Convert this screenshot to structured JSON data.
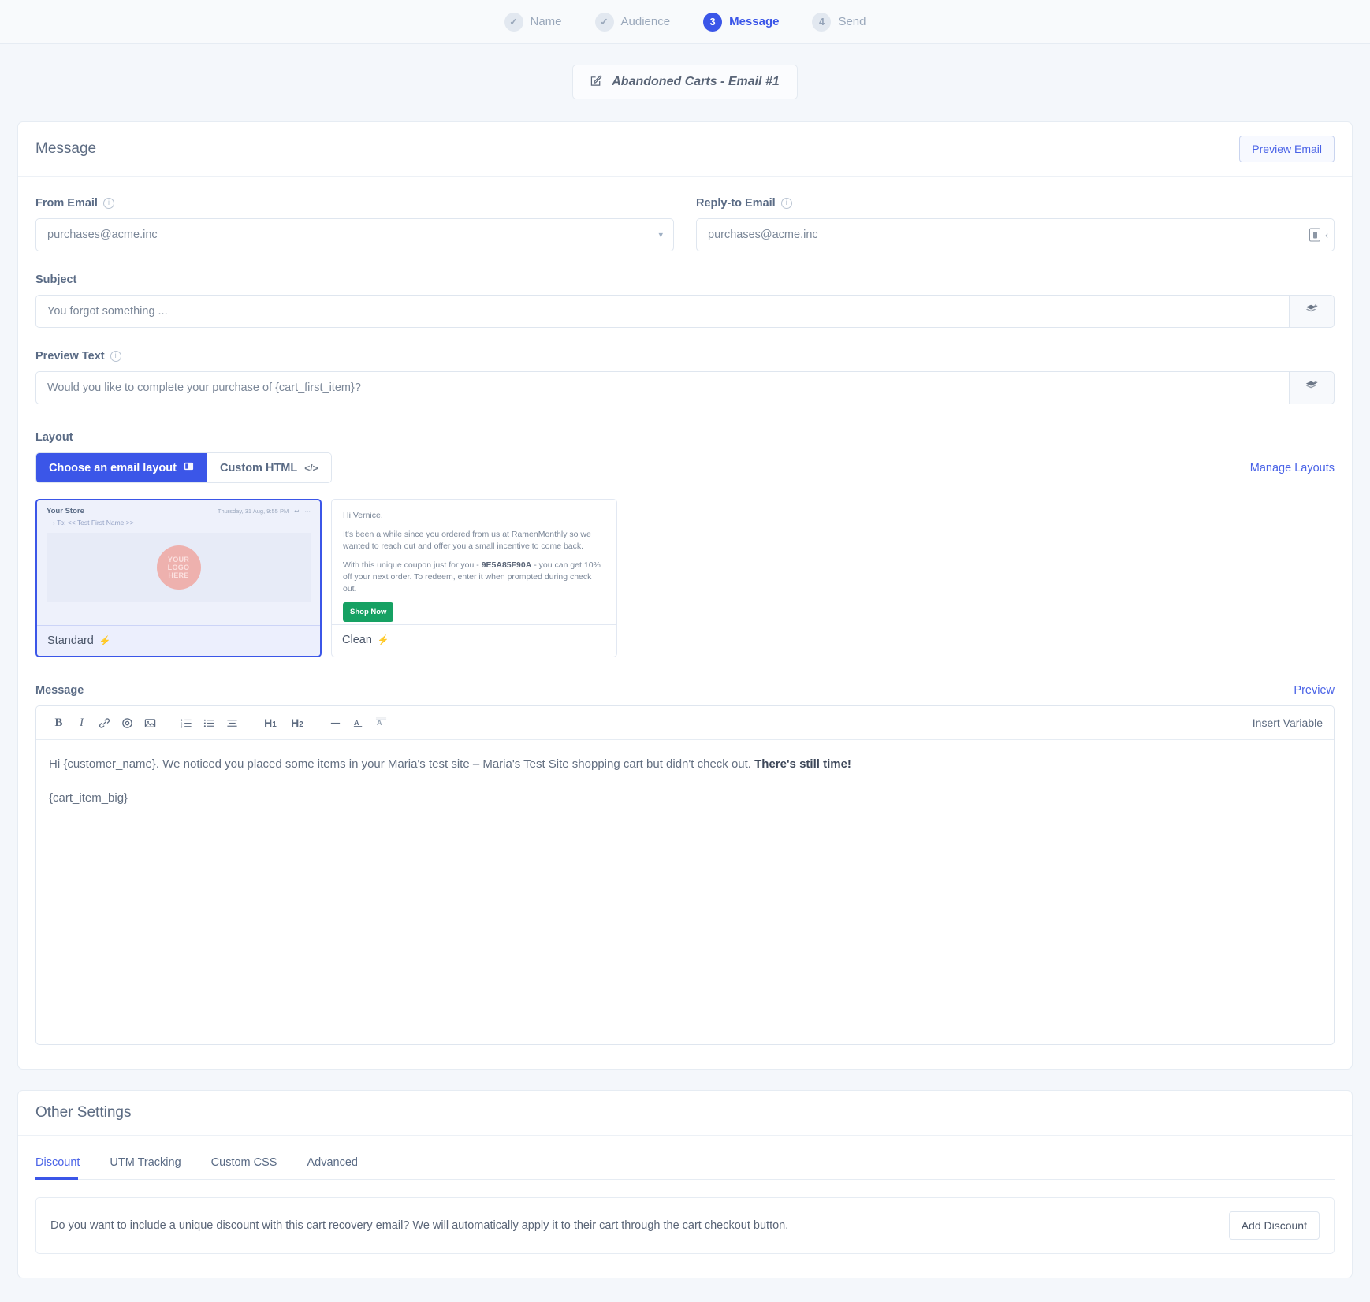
{
  "stepper": {
    "steps": [
      {
        "badge": "✓",
        "label": "Name",
        "state": "done"
      },
      {
        "badge": "✓",
        "label": "Audience",
        "state": "done"
      },
      {
        "badge": "3",
        "label": "Message",
        "state": "active"
      },
      {
        "badge": "4",
        "label": "Send",
        "state": "todo"
      }
    ]
  },
  "campaign": {
    "name": "Abandoned Carts - Email #1",
    "edit_icon": "pencil-square-icon"
  },
  "message_card": {
    "title": "Message",
    "preview_email_button": "Preview Email",
    "from_email": {
      "label": "From Email",
      "value": "purchases@acme.inc",
      "info_icon": "info-icon",
      "chevron_icon": "chevron-down-icon"
    },
    "reply_to_email": {
      "label": "Reply-to Email",
      "value": "purchases@acme.inc",
      "info_icon": "info-icon",
      "autofill_icon": "autofill-icon"
    },
    "subject": {
      "label": "Subject",
      "value": "You forgot something ...",
      "variable_button_icon": "insert-variable-icon"
    },
    "preview_text": {
      "label": "Preview Text",
      "value": "Would you like to complete your purchase of {cart_first_item}?",
      "info_icon": "info-icon",
      "variable_button_icon": "insert-variable-icon"
    },
    "layout": {
      "label": "Layout",
      "choose_tab": "Choose an email layout",
      "choose_tab_icon": "layout-icon",
      "custom_html_tab": "Custom HTML",
      "custom_html_tab_icon": "code-icon",
      "manage_layouts_link": "Manage Layouts",
      "cards": [
        {
          "name": "Standard",
          "selected": true,
          "bolt_icon": "lightning-icon",
          "preview": {
            "store": "Your Store",
            "date": "Thursday, 31 Aug, 9:55 PM",
            "to": "To: << Test First Name >>",
            "logo_lines": [
              "YOUR",
              "LOGO",
              "HERE"
            ],
            "reply_icon": "reply-icon",
            "more_icon": "ellipsis-icon",
            "expand_icon": "chevron-right-icon"
          }
        },
        {
          "name": "Clean",
          "selected": false,
          "bolt_icon": "lightning-icon",
          "preview": {
            "greeting": "Hi Vernice,",
            "para1": "It's been a while since you ordered from us at RamenMonthly so we wanted to reach out and offer you a small incentive to come back.",
            "para2_before": "With this unique coupon just for you - ",
            "coupon_code": "9E5A85F90A",
            "para2_after": " - you can get 10% off your next order. To redeem, enter it when prompted during check out.",
            "cta": "Shop Now"
          }
        }
      ]
    },
    "editor": {
      "label": "Message",
      "preview_link": "Preview",
      "insert_variable": "Insert Variable",
      "toolbar": [
        {
          "icon": "bold-icon",
          "glyph": "B"
        },
        {
          "icon": "italic-icon",
          "glyph": "I"
        },
        {
          "icon": "link-icon",
          "glyph": "🔗"
        },
        {
          "icon": "target-icon",
          "glyph": "◎"
        },
        {
          "icon": "image-icon",
          "glyph": "🖼"
        },
        {
          "icon": "ordered-list-icon",
          "glyph": "≔"
        },
        {
          "icon": "unordered-list-icon",
          "glyph": "☰"
        },
        {
          "icon": "align-icon",
          "glyph": "≡"
        },
        {
          "icon": "heading-1-icon",
          "glyph": "H₁"
        },
        {
          "icon": "heading-2-icon",
          "glyph": "H₂"
        },
        {
          "icon": "horizontal-rule-icon",
          "glyph": "—"
        },
        {
          "icon": "text-color-icon",
          "glyph": "A"
        },
        {
          "icon": "clear-format-icon",
          "glyph": "A"
        }
      ],
      "body_line1_a": "Hi {customer_name}. We noticed you placed some items in your Maria's test site – Maria's Test Site shopping cart but didn't check out. ",
      "body_line1_bold": "There's still time!",
      "body_line2": "{cart_item_big}"
    }
  },
  "other_settings": {
    "title": "Other Settings",
    "tabs": [
      {
        "label": "Discount",
        "active": true
      },
      {
        "label": "UTM Tracking",
        "active": false
      },
      {
        "label": "Custom CSS",
        "active": false
      },
      {
        "label": "Advanced",
        "active": false
      }
    ],
    "discount_panel": {
      "text": "Do you want to include a unique discount with this cart recovery email? We will automatically apply it to their cart through the cart checkout button.",
      "button": "Add Discount"
    }
  },
  "colors": {
    "accent": "#3b56e8",
    "link": "#4a63e7",
    "page_bg": "#f4f7fb",
    "green": "#16a163",
    "logo_pink": "#eeb1ae"
  }
}
